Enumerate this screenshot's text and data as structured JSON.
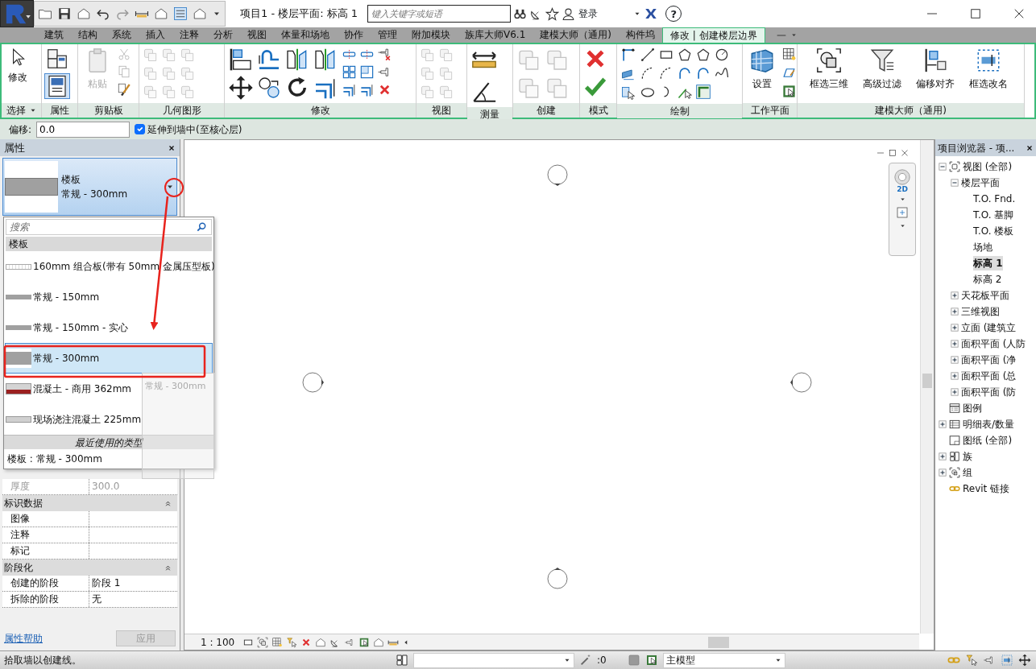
{
  "title_bar": {
    "title": "项目1 - 楼层平面: 标高 1",
    "search": {
      "placeholder": "键入关键字或短语"
    },
    "login": "登录",
    "help": "?"
  },
  "ribbon_tabs": [
    {
      "label": "建筑",
      "selected": false
    },
    {
      "label": "结构",
      "selected": false
    },
    {
      "label": "系统",
      "selected": false
    },
    {
      "label": "插入",
      "selected": false
    },
    {
      "label": "注释",
      "selected": false
    },
    {
      "label": "分析",
      "selected": false
    },
    {
      "label": "视图",
      "selected": false
    },
    {
      "label": "体量和场地",
      "selected": false
    },
    {
      "label": "协作",
      "selected": false
    },
    {
      "label": "管理",
      "selected": false
    },
    {
      "label": "附加模块",
      "selected": false
    },
    {
      "label": "族库大师V6.1",
      "selected": false
    },
    {
      "label": "建模大师（通用)",
      "selected": false
    },
    {
      "label": "构件坞",
      "selected": false
    },
    {
      "label": "修改 | 创建楼层边界",
      "selected": true
    }
  ],
  "ribbon_panels": [
    {
      "label": "选择",
      "dropdown": true,
      "buttons": [
        {
          "label": "修改",
          "disabled": false
        }
      ]
    },
    {
      "label": "属性",
      "dropdown": false
    },
    {
      "label": "剪贴板",
      "dropdown": false,
      "buttons": [
        {
          "label": "粘贴",
          "disabled": true
        }
      ]
    },
    {
      "label": "几何图形",
      "dropdown": false
    },
    {
      "label": "修改",
      "dropdown": false
    },
    {
      "label": "视图",
      "dropdown": false
    },
    {
      "label": "测量",
      "dropdown": false
    },
    {
      "label": "创建",
      "dropdown": false
    },
    {
      "label": "模式",
      "dropdown": false
    },
    {
      "label": "绘制",
      "dropdown": false
    },
    {
      "label": "工作平面",
      "dropdown": false,
      "buttons": [
        {
          "label": "设置",
          "disabled": false
        }
      ]
    },
    {
      "label": "建模大师（通用)",
      "dropdown": false,
      "buttons": [
        {
          "label": "框选三维",
          "disabled": false
        },
        {
          "label": "高级过滤",
          "disabled": false
        },
        {
          "label": "偏移对齐",
          "disabled": false
        },
        {
          "label": "框选改名",
          "disabled": false
        }
      ]
    }
  ],
  "options_bar": {
    "offset_label": "偏移:",
    "offset_value": "0.0",
    "extend_to_core": {
      "label": "延伸到墙中(至核心层)",
      "checked": true
    }
  },
  "properties": {
    "title": "属性",
    "type_family": "楼板",
    "type_name": "常规 - 300mm",
    "type_dropdown": {
      "search_placeholder": "搜索",
      "group": "楼板",
      "items": [
        {
          "label": "160mm 组合板(带有 50mm 金属压型板)",
          "kind": "composite",
          "selected": false
        },
        {
          "label": "常规 - 150mm",
          "kind": "generic",
          "selected": false
        },
        {
          "label": "常规 - 150mm - 实心",
          "kind": "generic",
          "selected": false
        },
        {
          "label": "常规 - 300mm",
          "kind": "thick",
          "selected": true
        },
        {
          "label": "混凝土 - 商用 362mm",
          "kind": "concrete",
          "selected": false
        },
        {
          "label": "现场浇注混凝土 225mm",
          "kind": "cast",
          "selected": false
        }
      ],
      "recent_header": "最近使用的类型",
      "recent_items": [
        "楼板 : 常规 - 300mm"
      ]
    },
    "drag_preview": "常规 - 300mm",
    "rows": [
      {
        "name": "厚度",
        "value": "300.0",
        "disabled": true
      }
    ],
    "sections": [
      {
        "label": "标识数据",
        "expanded": true,
        "rows": [
          {
            "name": "图像"
          },
          {
            "name": "注释"
          },
          {
            "name": "标记"
          }
        ]
      },
      {
        "label": "阶段化",
        "expanded": true,
        "rows": [
          {
            "name": "创建的阶段",
            "value": "阶段 1"
          },
          {
            "name": "拆除的阶段",
            "value": "无"
          }
        ]
      }
    ],
    "help_link": "属性帮助",
    "apply_button": {
      "label": "应用",
      "disabled": true
    }
  },
  "view": {
    "nav_label": "2D",
    "scale": "1 : 100"
  },
  "project_browser": {
    "title": "项目浏览器 - 项...",
    "tree": [
      {
        "label": "视图 (全部)",
        "kind": "views",
        "expanded": true,
        "selected": false,
        "children": [
          {
            "label": "楼层平面",
            "expanded": true,
            "selected": false,
            "children": [
              {
                "label": "T.O. Fnd.",
                "selected": false
              },
              {
                "label": "T.O. 基脚",
                "selected": false
              },
              {
                "label": "T.O. 楼板",
                "selected": false
              },
              {
                "label": "场地",
                "selected": false
              },
              {
                "label": "标高 1",
                "selected": true
              },
              {
                "label": "标高 2",
                "selected": false
              }
            ]
          },
          {
            "label": "天花板平面",
            "expanded": false,
            "selected": false
          },
          {
            "label": "三维视图",
            "expanded": false,
            "selected": false
          },
          {
            "label": "立面 (建筑立",
            "expanded": false,
            "selected": false
          },
          {
            "label": "面积平面 (人防",
            "expanded": false,
            "selected": false
          },
          {
            "label": "面积平面 (净",
            "expanded": false,
            "selected": false
          },
          {
            "label": "面积平面 (总",
            "expanded": false,
            "selected": false
          },
          {
            "label": "面积平面 (防",
            "expanded": false,
            "selected": false
          }
        ]
      },
      {
        "label": "图例",
        "kind": "legend",
        "selected": false
      },
      {
        "label": "明细表/数量",
        "kind": "schedule",
        "expanded": false,
        "selected": false
      },
      {
        "label": "图纸 (全部)",
        "kind": "sheet",
        "selected": false
      },
      {
        "label": "族",
        "kind": "family",
        "expanded": false,
        "selected": false
      },
      {
        "label": "组",
        "kind": "group",
        "expanded": false,
        "selected": false
      },
      {
        "label": "Revit 链接",
        "kind": "link",
        "selected": false
      }
    ]
  },
  "status_bar": {
    "message": "拾取墙以创建线。",
    "count": ":0",
    "workset": "主模型"
  }
}
